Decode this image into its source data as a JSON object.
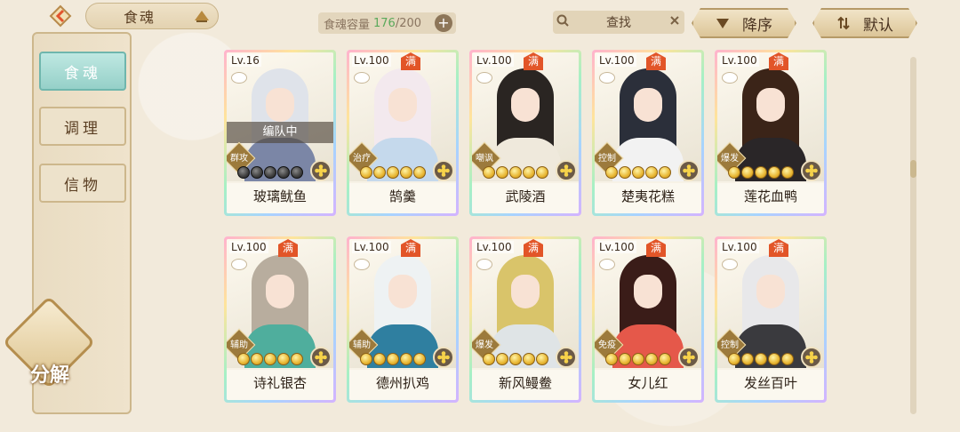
{
  "header": {
    "title": "食魂",
    "capacity_label": "食魂容量",
    "capacity_current": "176",
    "capacity_separator": "/",
    "capacity_max": "200",
    "search_placeholder": "查找",
    "sort_desc_label": "降序",
    "sort_default_label": "默认"
  },
  "sidebar": {
    "items": [
      {
        "label": "食魂",
        "active": true
      },
      {
        "label": "调理",
        "active": false
      },
      {
        "label": "信物",
        "active": false
      }
    ],
    "decompose_label": "分解"
  },
  "cards": [
    {
      "level": "Lv.16",
      "max": "",
      "team": "编队中",
      "role": "群攻",
      "stars": 5,
      "dark_stars": 5,
      "name": "玻璃鱿鱼",
      "hair": "#dfe3ea",
      "body": "#7b86a6"
    },
    {
      "level": "Lv.100",
      "max": "满",
      "team": "",
      "role": "治疗",
      "stars": 5,
      "dark_stars": 0,
      "name": "鹄羹",
      "hair": "#f3e9ee",
      "body": "#c5d9ec"
    },
    {
      "level": "Lv.100",
      "max": "满",
      "team": "",
      "role": "嘲讽",
      "stars": 5,
      "dark_stars": 0,
      "name": "武陵酒",
      "hair": "#2a2522",
      "body": "#efe9dc"
    },
    {
      "level": "Lv.100",
      "max": "满",
      "team": "",
      "role": "控制",
      "stars": 5,
      "dark_stars": 0,
      "name": "楚夷花糕",
      "hair": "#2b2f3a",
      "body": "#f2f2f2"
    },
    {
      "level": "Lv.100",
      "max": "满",
      "team": "",
      "role": "爆发",
      "stars": 5,
      "dark_stars": 0,
      "name": "莲花血鸭",
      "hair": "#3b2418",
      "body": "#2a2628"
    },
    {
      "level": "Lv.100",
      "max": "满",
      "team": "",
      "role": "辅助",
      "stars": 5,
      "dark_stars": 0,
      "name": "诗礼银杏",
      "hair": "#b8ad9e",
      "body": "#4fae9d"
    },
    {
      "level": "Lv.100",
      "max": "满",
      "team": "",
      "role": "辅助",
      "stars": 5,
      "dark_stars": 0,
      "name": "德州扒鸡",
      "hair": "#eef2f3",
      "body": "#2f7fa0"
    },
    {
      "level": "Lv.100",
      "max": "满",
      "team": "",
      "role": "爆发",
      "stars": 5,
      "dark_stars": 0,
      "name": "新风鳗鲞",
      "hair": "#d9c46a",
      "body": "#dfe4e6"
    },
    {
      "level": "Lv.100",
      "max": "满",
      "team": "",
      "role": "免疫",
      "stars": 5,
      "dark_stars": 0,
      "name": "女儿红",
      "hair": "#3a1c18",
      "body": "#e5584a"
    },
    {
      "level": "Lv.100",
      "max": "满",
      "team": "",
      "role": "控制",
      "stars": 5,
      "dark_stars": 0,
      "name": "发丝百叶",
      "hair": "#e8e8ea",
      "body": "#3a3a3e"
    }
  ]
}
